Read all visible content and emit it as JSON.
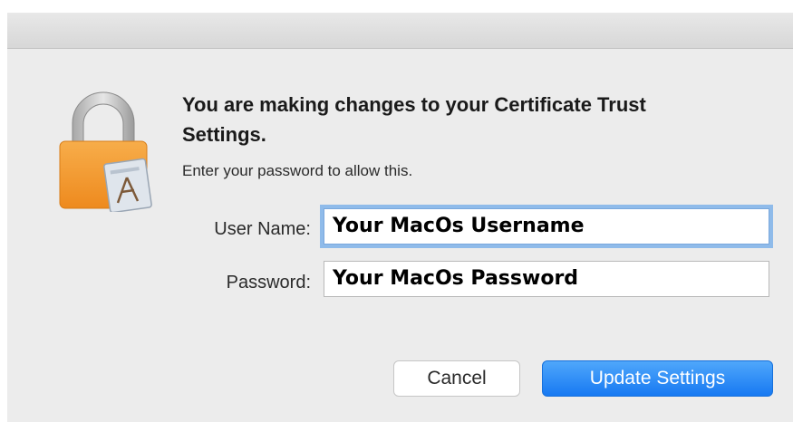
{
  "dialog": {
    "heading": "You are making changes to your Certificate Trust Settings.",
    "subtext": "Enter your password to allow this.",
    "icon": "lock-certificate-icon"
  },
  "form": {
    "username_label": "User Name:",
    "username_value": "Your MacOs Username",
    "password_label": "Password:",
    "password_value": "Your MacOs Password"
  },
  "buttons": {
    "cancel_label": "Cancel",
    "update_label": "Update Settings"
  },
  "colors": {
    "accent": "#1779f2",
    "lock_body": "#f59a2c",
    "focus_ring": "#8fbbea"
  }
}
